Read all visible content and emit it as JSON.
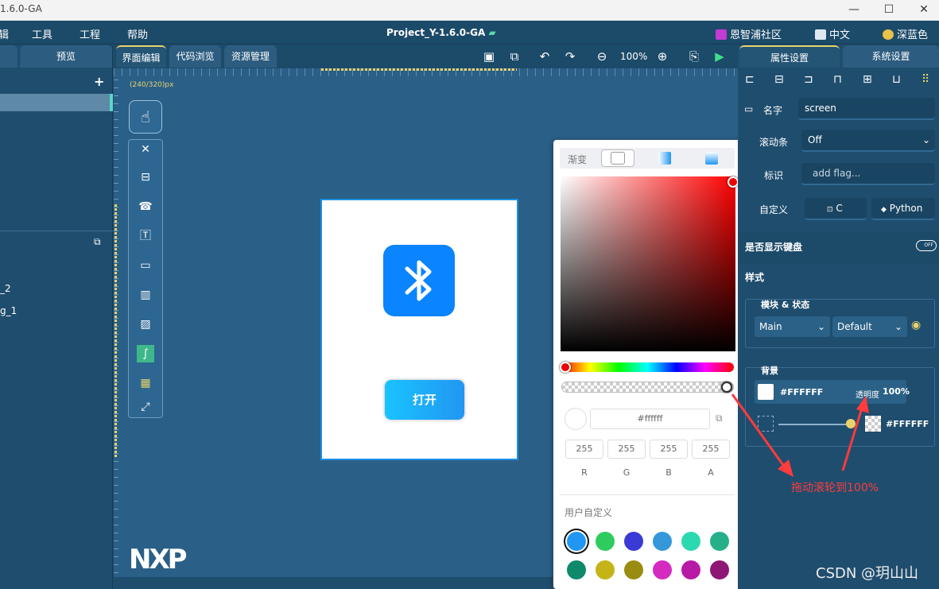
{
  "window": {
    "title_fragment": "1.6.0-GA",
    "project_title": "Project_Y-1.6.0-GA",
    "minimize": "—",
    "maximize": "☐",
    "close": "✕"
  },
  "menu": {
    "items": [
      "辑",
      "工具",
      "工程",
      "帮助"
    ],
    "community": "恩智浦社区",
    "language": "中文",
    "theme": "深蓝色"
  },
  "left_panel": {
    "tab_preview": "预览",
    "add": "+",
    "items": [
      "_2",
      "g_1"
    ]
  },
  "editor_tabs": [
    "界面编辑",
    "代码浏览",
    "资源管理"
  ],
  "toolbar": {
    "zoom": "100%"
  },
  "canvas": {
    "size_label": "(240/320)px",
    "open_button": "打开",
    "logo": "NXP"
  },
  "color_picker": {
    "gradient_label": "渐变",
    "hex": "#ffffff",
    "rgba_values": [
      "255",
      "255",
      "255",
      "255"
    ],
    "rgba_labels": [
      "R",
      "G",
      "B",
      "A"
    ],
    "custom_label": "用户自定义",
    "swatches_row1": [
      "#2196f3",
      "#2ecc5f",
      "#3a3ad6",
      "#3498db",
      "#2bd9b0",
      "#25b08a"
    ],
    "swatches_row2": [
      "#0e8a6a",
      "#c4b418",
      "#9a8c10",
      "#d52ac0",
      "#b81aa8",
      "#8e1675"
    ]
  },
  "right_panel": {
    "tabs": [
      "属性设置",
      "系统设置"
    ],
    "name_label": "名字",
    "name_value": "screen",
    "scrollbar_label": "滚动条",
    "scrollbar_value": "Off",
    "flag_label": "标识",
    "flag_placeholder": "add flag...",
    "custom_label": "自定义",
    "custom_c": "C",
    "custom_python": "Python",
    "keyboard_label": "是否显示键盘",
    "toggle_text": "OFF",
    "style_label": "样式",
    "module_state_label": "模块 & 状态",
    "module_value": "Main",
    "state_value": "Default",
    "bg_label": "背景",
    "bg_color": "#FFFFFF",
    "opacity_label": "透明度",
    "opacity_value": "100%",
    "grad_color": "#FFFFFF"
  },
  "annotation": {
    "text": "拖动滚轮到100%"
  },
  "watermark": "CSDN @玥山山",
  "colors": {
    "accent_yellow": "#e8d36a",
    "panel_bg": "#1f4d6e",
    "editor_bg": "#2a5f87",
    "annotation_red": "#ff3b3b"
  }
}
